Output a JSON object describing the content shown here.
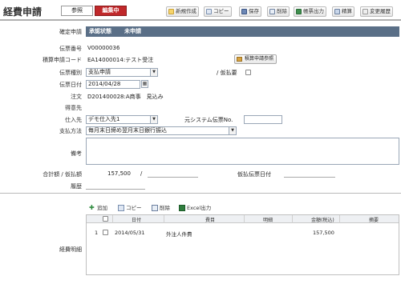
{
  "header": {
    "title": "経費申請",
    "mode_view": "参照",
    "mode_edit": "編集中",
    "toolbar": {
      "new": "新規作成",
      "copy": "コピー",
      "save": "保存",
      "delete": "削除",
      "export": "帳票出力",
      "settle": "精算",
      "history": "変更履歴"
    }
  },
  "form": {
    "confirm_label": "確定申請",
    "approval_status_label": "承認状態",
    "approval_status_value": "未申請",
    "slip_no_label": "伝票番号",
    "slip_no_value": "V00000036",
    "budget_code_label": "積算申請コード",
    "budget_code_value": "EA14000014:テスト受注",
    "budget_ref_button": "積算申請参照",
    "slip_type_label": "伝票種別",
    "slip_type_value": "支払申請",
    "provisional_label": "/ 仮払要",
    "slip_date_label": "伝票日付",
    "slip_date_value": "2014/04/28",
    "order_label": "注文",
    "order_value": "D201400028:A商事　見込み",
    "client_label": "得意先",
    "client_value": "",
    "supplier_label": "仕入先",
    "supplier_value": "デモ仕入先1",
    "external_slip_label": "元システム伝票No.",
    "external_slip_value": "",
    "payment_method_label": "支払方法",
    "payment_method_value": "毎月末日締め翌月末日銀行振込",
    "remarks_label": "備考",
    "remarks_value": "",
    "total_label": "合計額 / 仮払額",
    "total_value": "157,500",
    "slash": "/",
    "provisional_value": "",
    "provisional_slip_date_label": "仮払伝票日付",
    "provisional_slip_date_value": "",
    "history_label": "履歴",
    "history_value": "",
    "detail_label": "経費明細"
  },
  "grid": {
    "toolbar": {
      "add": "追加",
      "copy": "コピー",
      "delete": "削除",
      "excel": "Excel出力"
    },
    "columns": [
      "日付",
      "費目",
      "明細",
      "金額(税込)",
      "摘要"
    ],
    "rows": [
      {
        "no": "1",
        "date": "2014/05/31",
        "item": "外注人件費",
        "detail": "",
        "amount": "157,500",
        "note": ""
      }
    ]
  },
  "colors": {
    "accent": "#c0282a",
    "status_bar": "#5a6f87"
  }
}
